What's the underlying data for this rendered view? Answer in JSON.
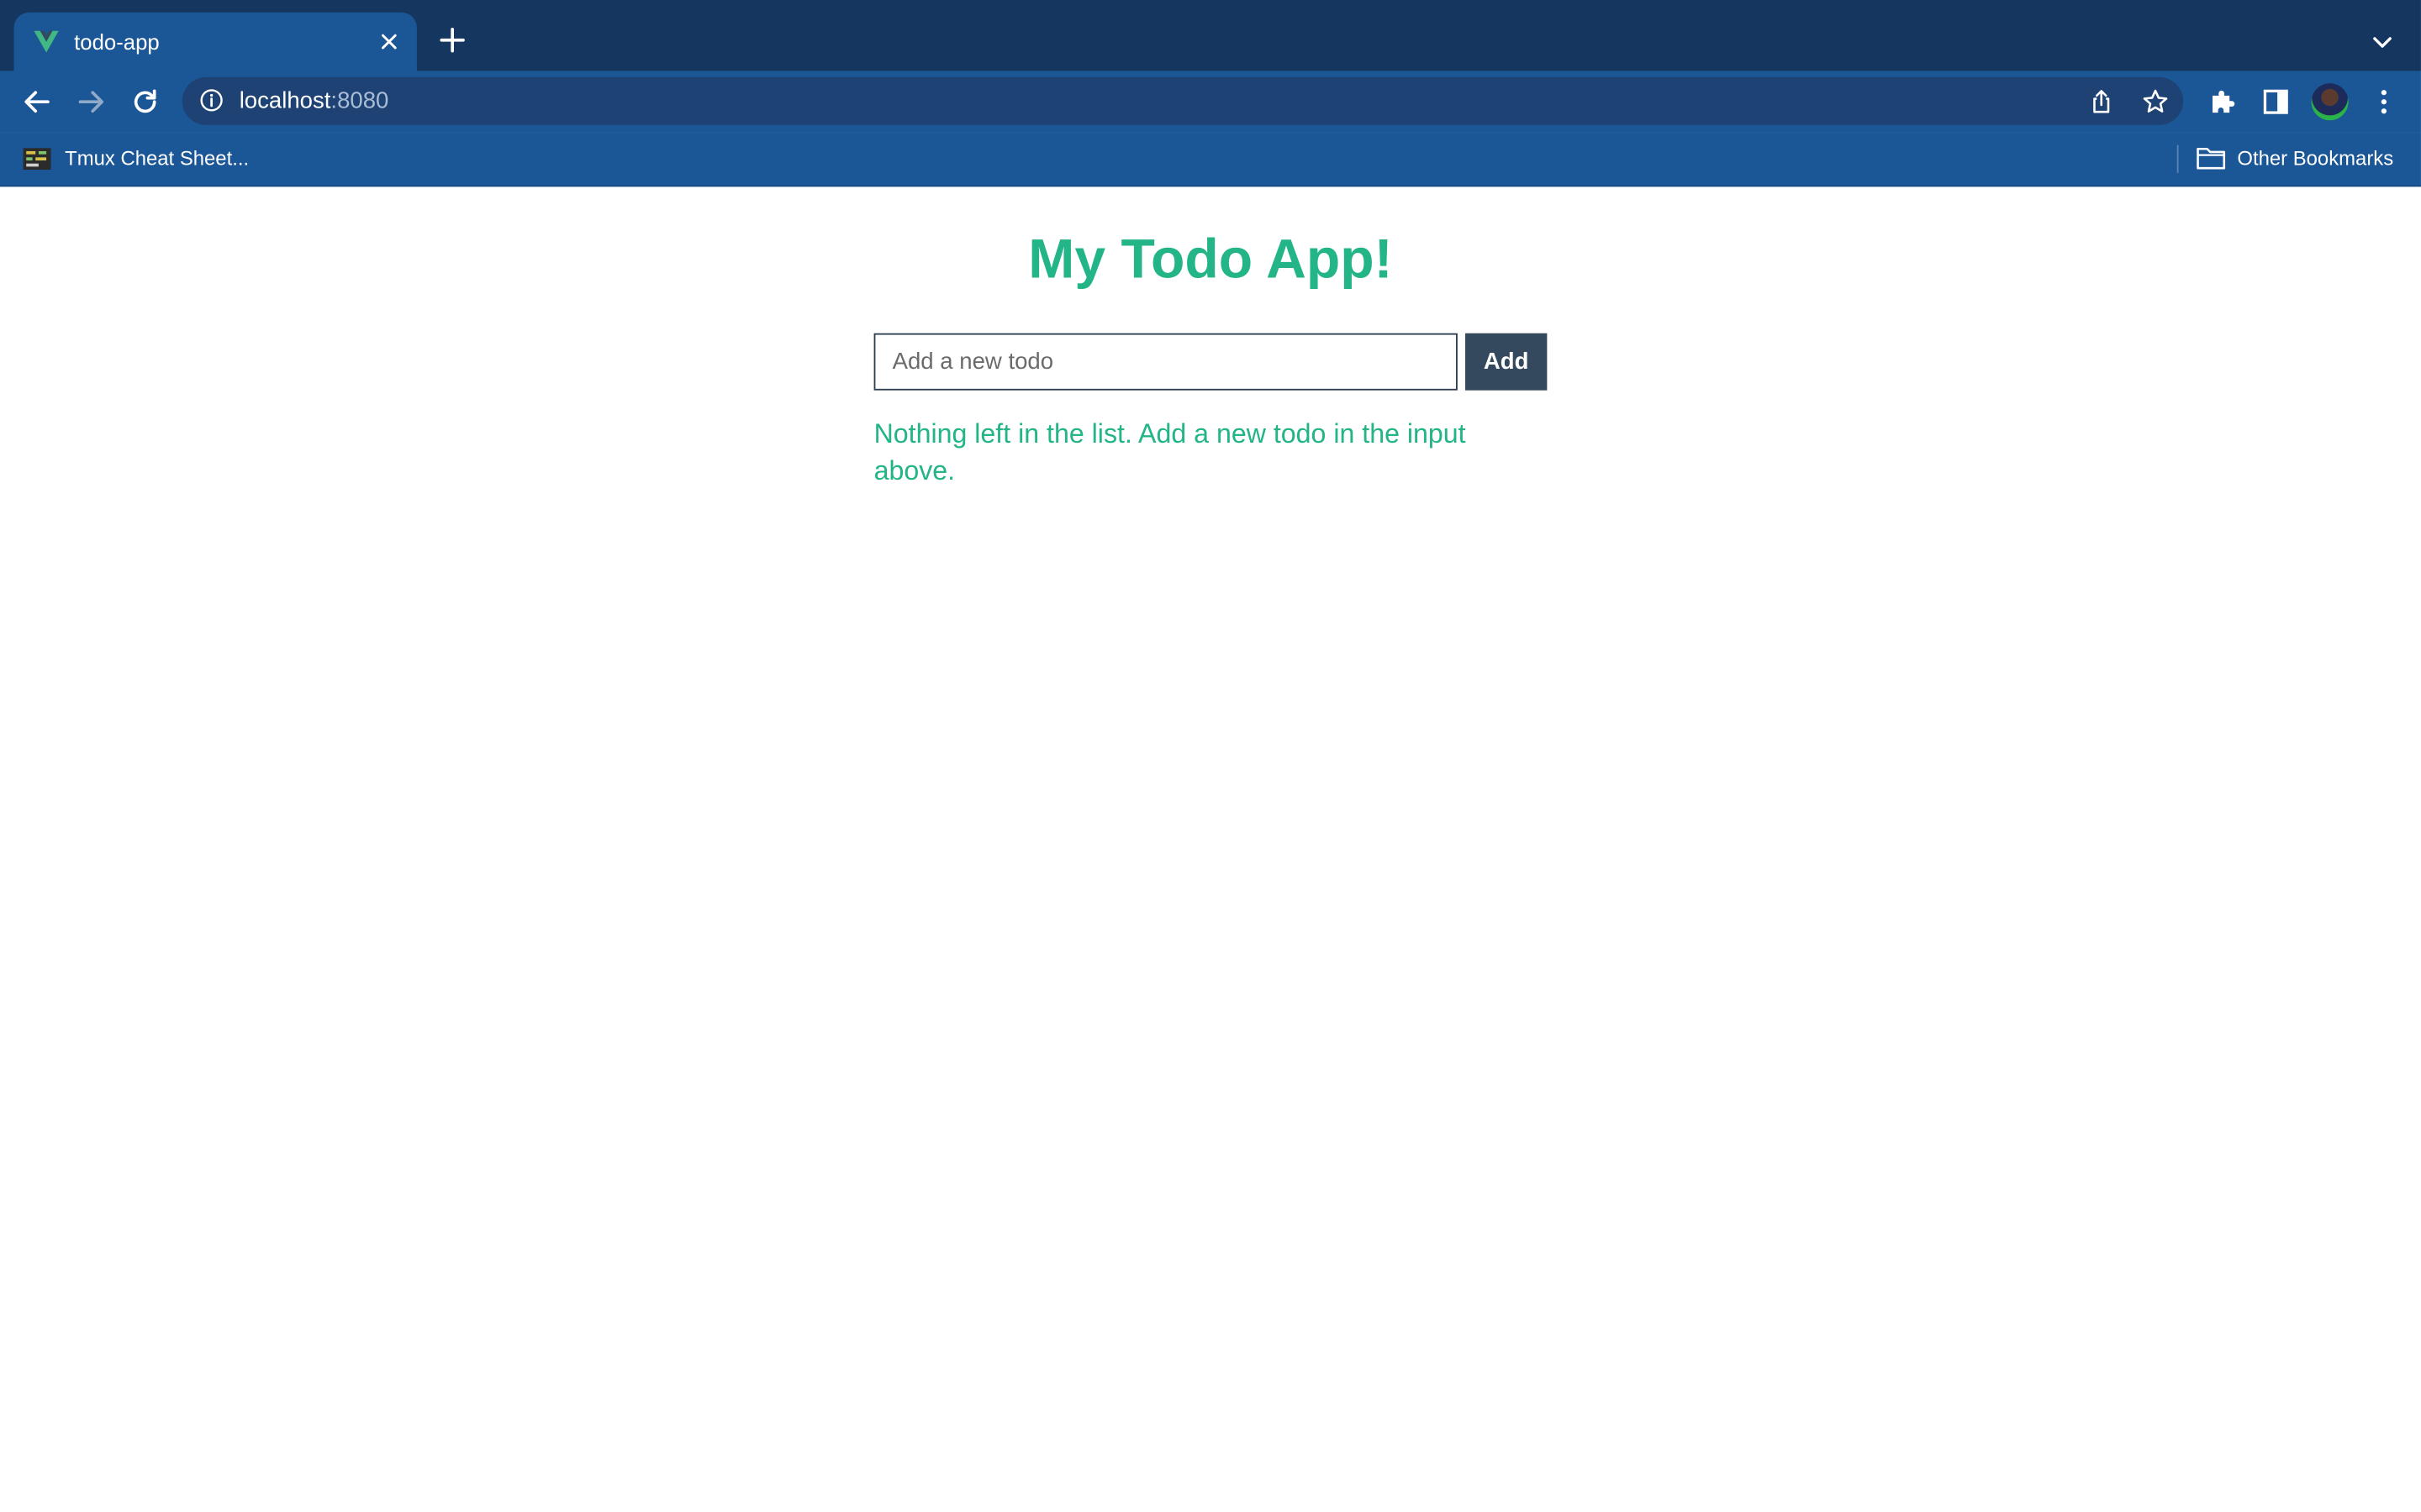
{
  "browser": {
    "tab": {
      "title": "todo-app",
      "favicon": "vue-logo-icon"
    },
    "address": {
      "host": "localhost",
      "port": ":8080"
    },
    "bookmarks": [
      {
        "label": "Tmux Cheat Sheet..."
      }
    ],
    "other_bookmarks_label": "Other Bookmarks",
    "theme": {
      "tabstrip": "#14365f",
      "toolbar": "#1b5696",
      "omnibox": "#1d4273"
    }
  },
  "app": {
    "title": "My Todo App!",
    "input": {
      "placeholder": "Add a new todo",
      "value": ""
    },
    "add_button_label": "Add",
    "empty_message": "Nothing left in the list. Add a new todo in the input above.",
    "accent_color": "#23b487",
    "button_color": "#34495e"
  }
}
